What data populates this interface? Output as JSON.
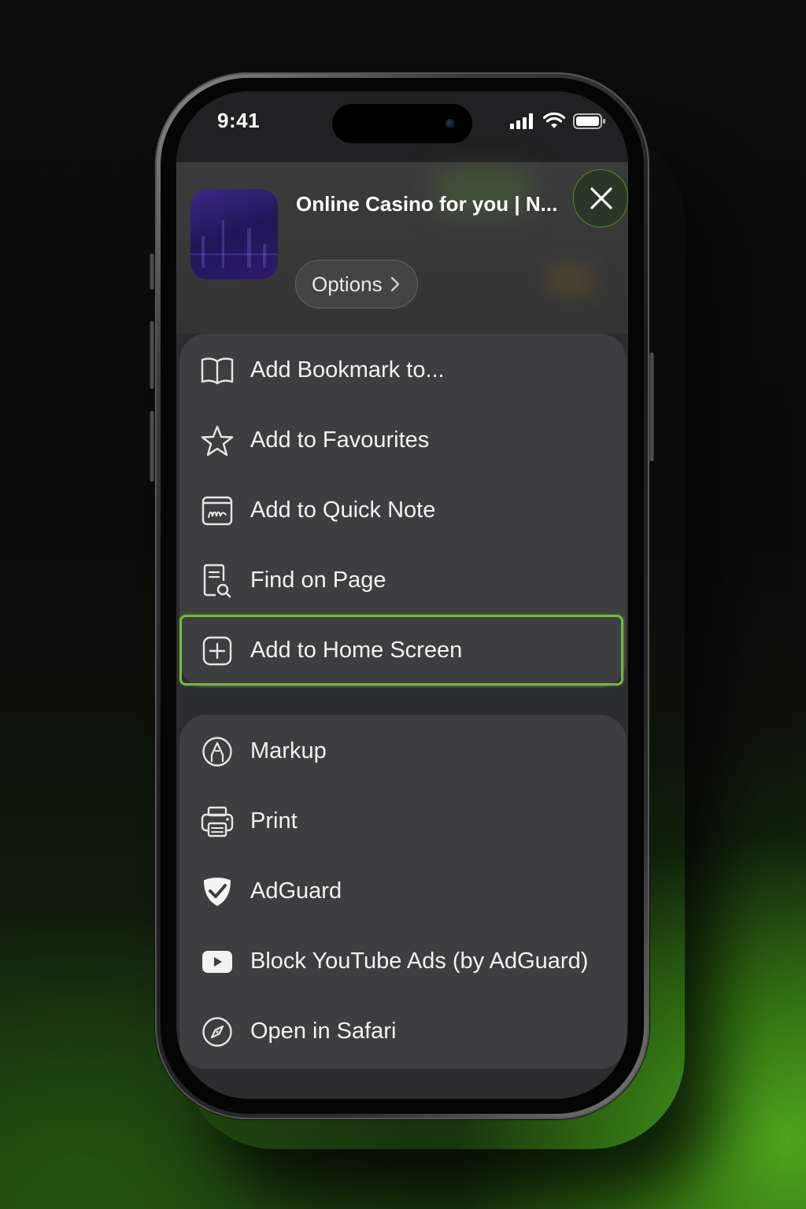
{
  "status_bar": {
    "time": "9:41"
  },
  "header": {
    "page_title": "Online Casino for you | N...",
    "options_label": "Options",
    "close_icon": "close-icon",
    "chevron_icon": "chevron-right-icon"
  },
  "menu": {
    "group1": [
      {
        "label": "Add Bookmark to...",
        "icon": "book-icon"
      },
      {
        "label": "Add to Favourites",
        "icon": "star-icon"
      },
      {
        "label": "Add to Quick Note",
        "icon": "quick-note-icon"
      },
      {
        "label": "Find on Page",
        "icon": "find-on-page-icon"
      },
      {
        "label": "Add to Home Screen",
        "icon": "add-square-icon",
        "highlighted": true
      }
    ],
    "group2": [
      {
        "label": "Markup",
        "icon": "markup-icon"
      },
      {
        "label": "Print",
        "icon": "printer-icon"
      },
      {
        "label": "AdGuard",
        "icon": "adguard-shield-icon"
      },
      {
        "label": "Block YouTube Ads (by AdGuard)",
        "icon": "youtube-icon"
      },
      {
        "label": "Open in Safari",
        "icon": "compass-icon"
      }
    ]
  },
  "colors": {
    "highlight": "#6fbf3a",
    "menu_bg": "#3d3e40",
    "text": "#f2f2f2",
    "backdrop_glow": "#4fa01e"
  }
}
